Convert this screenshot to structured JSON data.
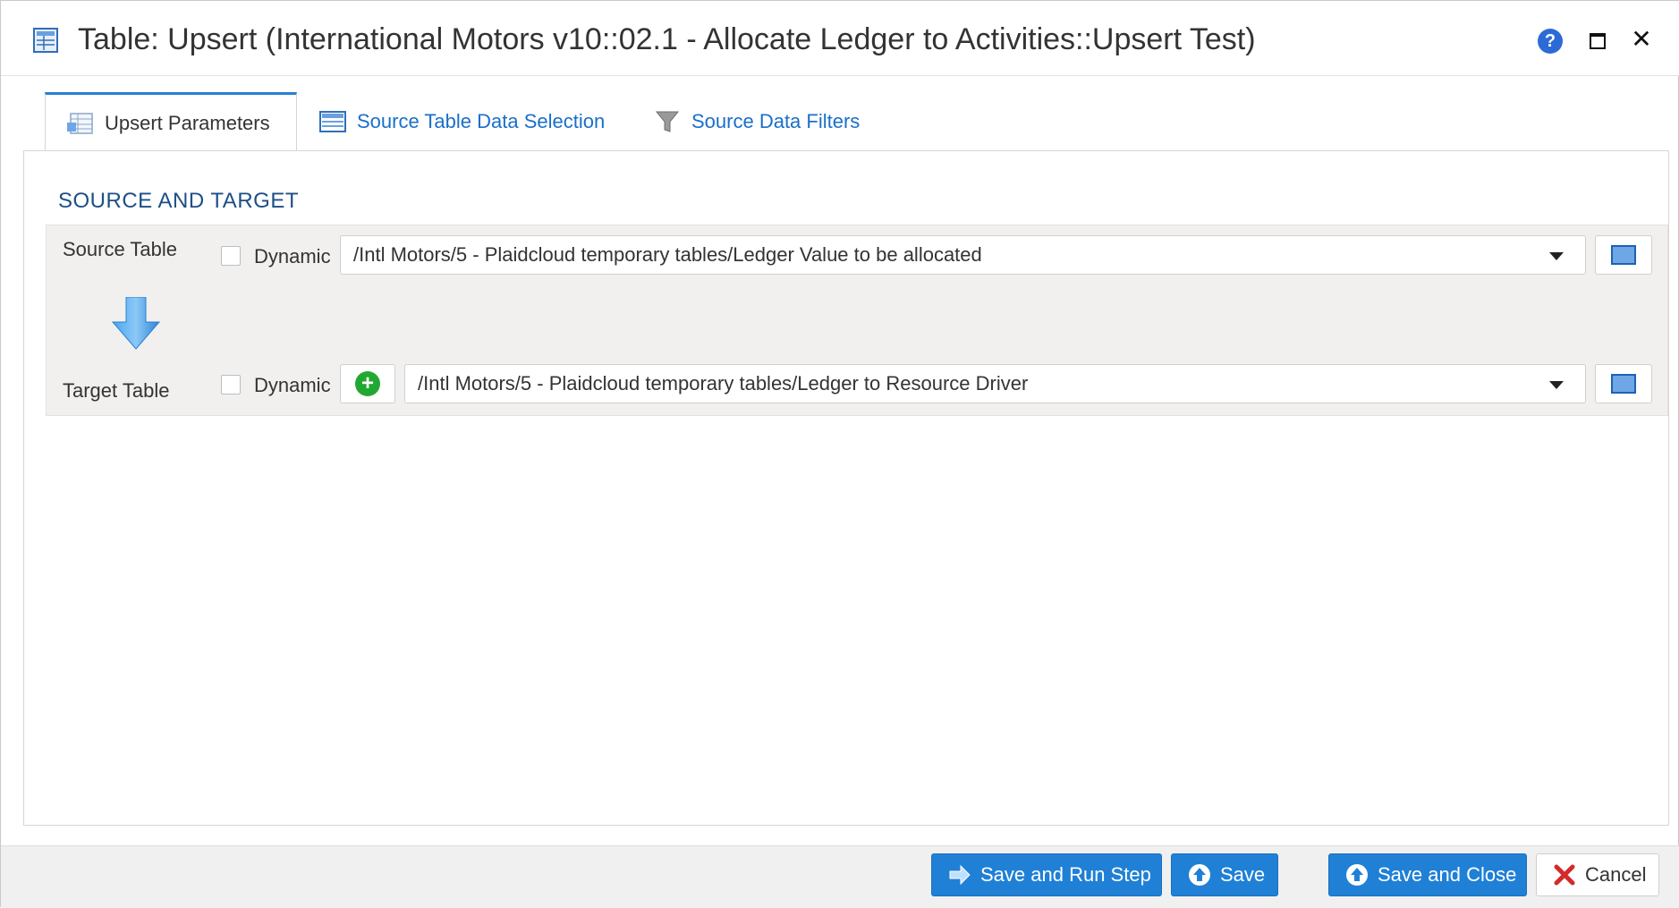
{
  "window": {
    "title": "Table: Upsert (International Motors v10::02.1 - Allocate Ledger to Activities::Upsert Test)",
    "help_label": "?",
    "close_label": "✕"
  },
  "tabs": [
    {
      "label": "Upsert Parameters",
      "active": true
    },
    {
      "label": "Source Table Data Selection",
      "active": false
    },
    {
      "label": "Source Data Filters",
      "active": false
    }
  ],
  "section": {
    "title": "SOURCE AND TARGET",
    "source": {
      "label": "Source Table",
      "dynamic_label": "Dynamic",
      "dynamic_checked": false,
      "value": "/Intl Motors/5 - Plaidcloud temporary tables/Ledger Value to be allocated"
    },
    "target": {
      "label": "Target Table",
      "dynamic_label": "Dynamic",
      "dynamic_checked": false,
      "add_label": "+",
      "value": "/Intl Motors/5 - Plaidcloud temporary tables/Ledger to Resource Driver"
    }
  },
  "footer": {
    "save_run_label": "Save and Run Step",
    "save_label": "Save",
    "save_close_label": "Save and Close",
    "cancel_label": "Cancel"
  },
  "colors": {
    "accent": "#1f80d6",
    "tab_link": "#1a6fc9",
    "section_title": "#1d4f86",
    "add_green": "#22a832",
    "cancel_red": "#d42a2a"
  }
}
